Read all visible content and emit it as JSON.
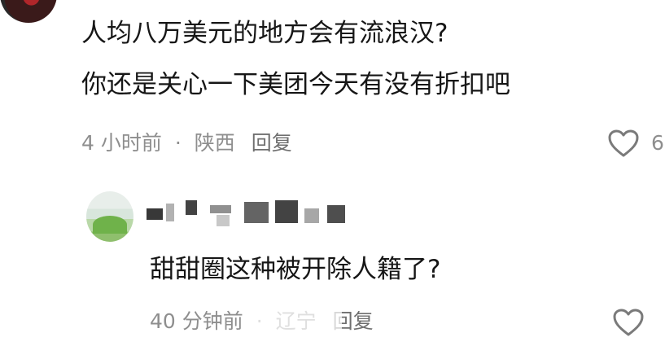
{
  "comment": {
    "line1": "人均八万美元的地方会有流浪汉?",
    "line2": "你还是关心一下美团今天有没有折扣吧",
    "time": "4 小时前",
    "separator": "·",
    "location": "陕西",
    "reply_label": "回复",
    "like_count": "6",
    "like_icon": "heart-outline-icon"
  },
  "reply": {
    "text": "甜甜圈这种被开除人籍了?",
    "time": "40 分钟前",
    "separator": "·",
    "location": "辽宁",
    "reply_label": "回复",
    "like_icon": "heart-outline-icon"
  },
  "colors": {
    "text_primary": "#161616",
    "text_secondary": "#8e8e8e",
    "background": "#ffffff"
  }
}
